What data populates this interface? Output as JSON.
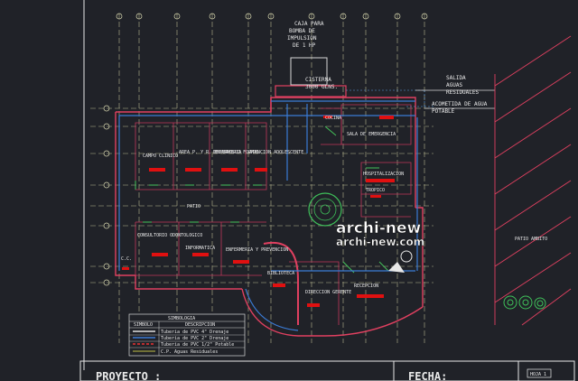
{
  "labels": {
    "caja_para": "CAJA PARA",
    "bomba": "BOMBA DE",
    "impulsion": "IMPULSION",
    "hp": "DE 1 HP",
    "cisterna": "CISTERNA",
    "glns": "3000 GLNS.",
    "salida": "SALIDA",
    "aguas": "AGUAS",
    "residuales": "RESIDUALES",
    "acometida": "ACOMETIDA DE AGUA",
    "potable": "POTABLE",
    "proyecto": "PROYECTO :",
    "fecha": "FECHA:",
    "hoja": "HOJA 1"
  },
  "rooms": {
    "campo_clinico": "CAMPO CLINICO",
    "area_pyr": "AREA P. Y R. ENFERMERIA",
    "desarrollo": "DESARROLLO FORMAL",
    "atencion_adolescente": "ATENCION ADOLESCENTE",
    "patio": "PATIO",
    "cocina": "COCINA",
    "sala_emergencia": "SALA DE EMERGENCIA",
    "hospitalizacion": "HOSPITALIZACION",
    "tropico": "TROPICO",
    "consultorio": "CONSULTORIO ODONTOLOGICO",
    "informatica": "INFORMATICA",
    "enfermeria": "ENFERMERIA Y PREVENCION",
    "biblioteca": "BIBLIOTECA",
    "recepcion": "RECEPCION",
    "direccion": "DIRECCION GERENTE",
    "cc": "C.C.",
    "patio_ambito": "PATIO AMBITO"
  },
  "legend": {
    "title": "SIMBOLOGIA",
    "col_symbol": "SIMBOLO",
    "col_desc": "DESCRIPCION",
    "rows": [
      {
        "desc": "Tuberia de PVC 4\" Drenaje",
        "color": "#e0e0e0"
      },
      {
        "desc": "Tuberia de PVC 2\" Drenaje",
        "color": "#3a7bd5"
      },
      {
        "desc": "Tuberia de PVC 1/2\" Potable",
        "color": "#e33"
      },
      {
        "desc": "C.P. Aguas Residuales",
        "color": "#8a8a3a"
      }
    ]
  },
  "watermark": {
    "brand": "archi-new",
    "url": "archi-new.com"
  },
  "colors": {
    "wall": "#e04060",
    "wall2": "#c0365a",
    "pipe_blue": "#3a7bd5",
    "grid": "#c8c8a0",
    "room_line": "#44c25a",
    "label_red": "#e01010"
  }
}
